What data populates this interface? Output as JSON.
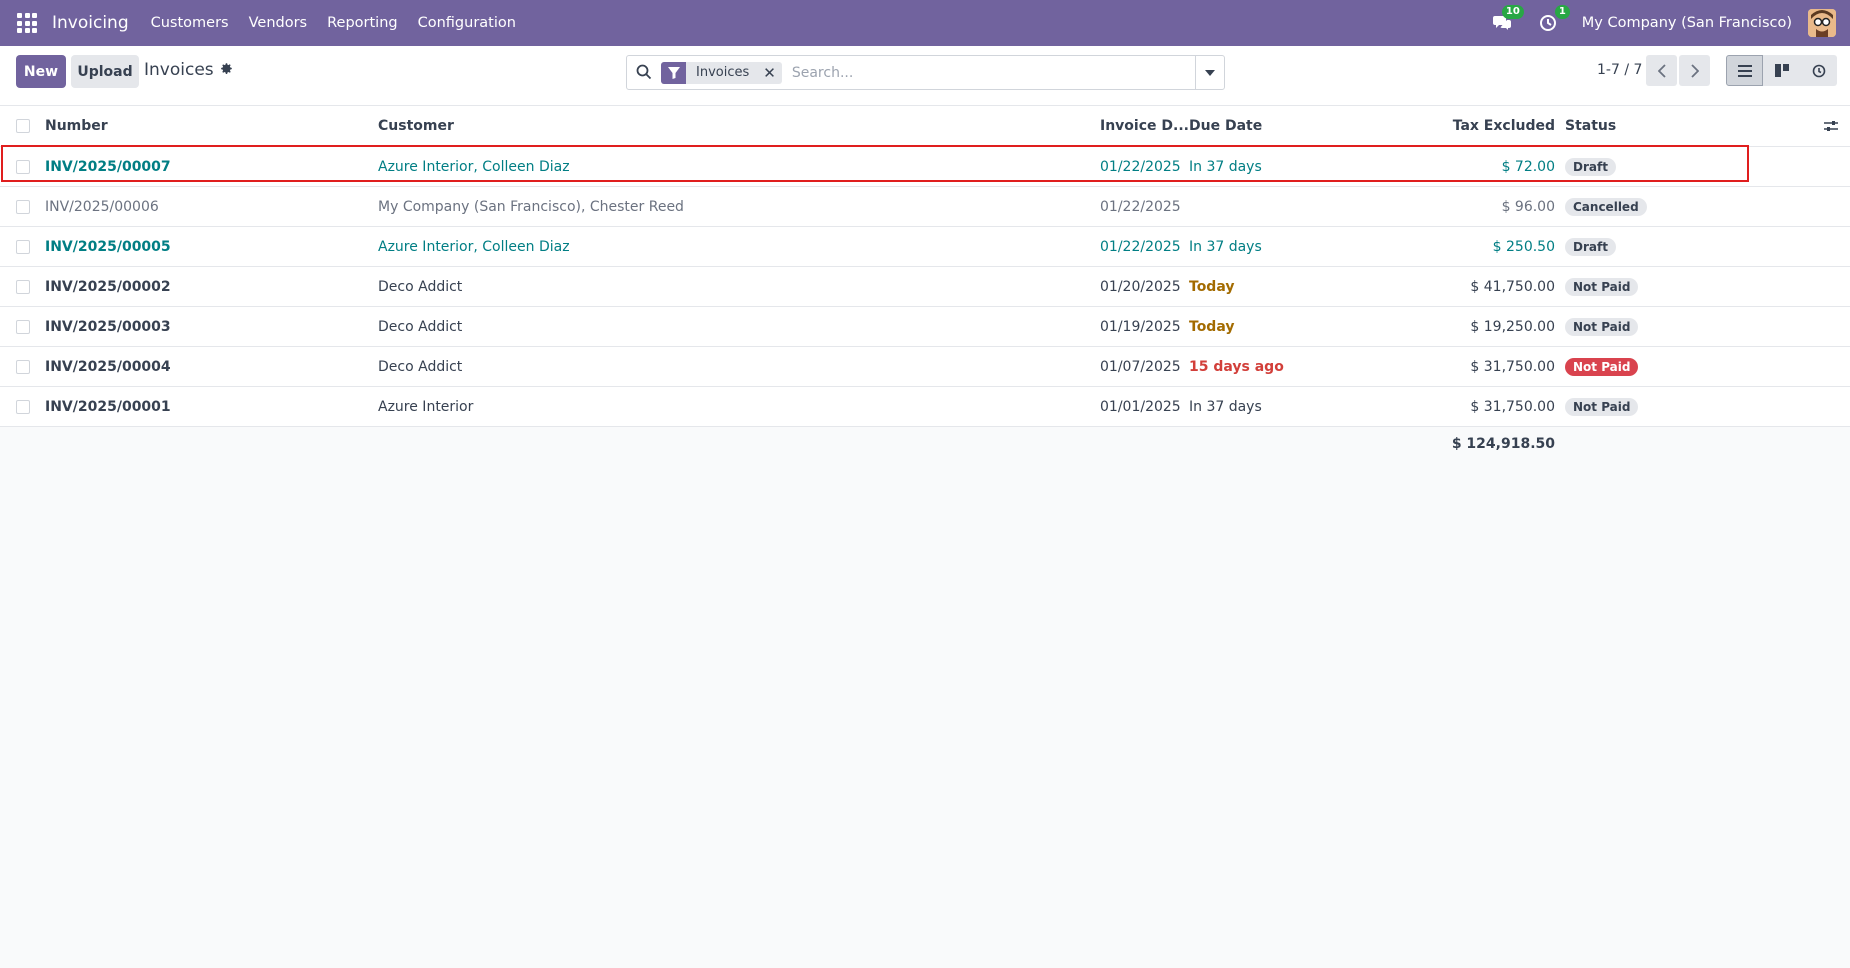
{
  "nav": {
    "app_name": "Invoicing",
    "menu": [
      "Customers",
      "Vendors",
      "Reporting",
      "Configuration"
    ],
    "messages_count": "10",
    "activities_count": "1",
    "company": "My Company (San Francisco)"
  },
  "control": {
    "new_label": "New",
    "upload_label": "Upload",
    "title": "Invoices",
    "facet_label": "Invoices",
    "search_placeholder": "Search...",
    "pager": "1-7 / 7"
  },
  "table": {
    "headers": {
      "number": "Number",
      "customer": "Customer",
      "invoice_date": "Invoice D...",
      "due_date": "Due Date",
      "tax_excluded": "Tax Excluded",
      "status": "Status"
    },
    "rows": [
      {
        "number": "INV/2025/00007",
        "customer": "Azure Interior, Colleen Diaz",
        "invoice_date": "01/22/2025",
        "due": "In 37 days",
        "tax": "$ 72.00",
        "status": "Draft"
      },
      {
        "number": "INV/2025/00006",
        "customer": "My Company (San Francisco), Chester Reed",
        "invoice_date": "01/22/2025",
        "due": "",
        "tax": "$ 96.00",
        "status": "Cancelled"
      },
      {
        "number": "INV/2025/00005",
        "customer": "Azure Interior, Colleen Diaz",
        "invoice_date": "01/22/2025",
        "due": "In 37 days",
        "tax": "$ 250.50",
        "status": "Draft"
      },
      {
        "number": "INV/2025/00002",
        "customer": "Deco Addict",
        "invoice_date": "01/20/2025",
        "due": "Today",
        "tax": "$ 41,750.00",
        "status": "Not Paid"
      },
      {
        "number": "INV/2025/00003",
        "customer": "Deco Addict",
        "invoice_date": "01/19/2025",
        "due": "Today",
        "tax": "$ 19,250.00",
        "status": "Not Paid"
      },
      {
        "number": "INV/2025/00004",
        "customer": "Deco Addict",
        "invoice_date": "01/07/2025",
        "due": "15 days ago",
        "tax": "$ 31,750.00",
        "status": "Not Paid"
      },
      {
        "number": "INV/2025/00001",
        "customer": "Azure Interior",
        "invoice_date": "01/01/2025",
        "due": "In 37 days",
        "tax": "$ 31,750.00",
        "status": "Not Paid"
      }
    ],
    "total": "$ 124,918.50"
  },
  "colors": {
    "brand": "#71639e",
    "link_teal": "#017e84",
    "warning": "#a36b00",
    "danger": "#d23f3a"
  }
}
